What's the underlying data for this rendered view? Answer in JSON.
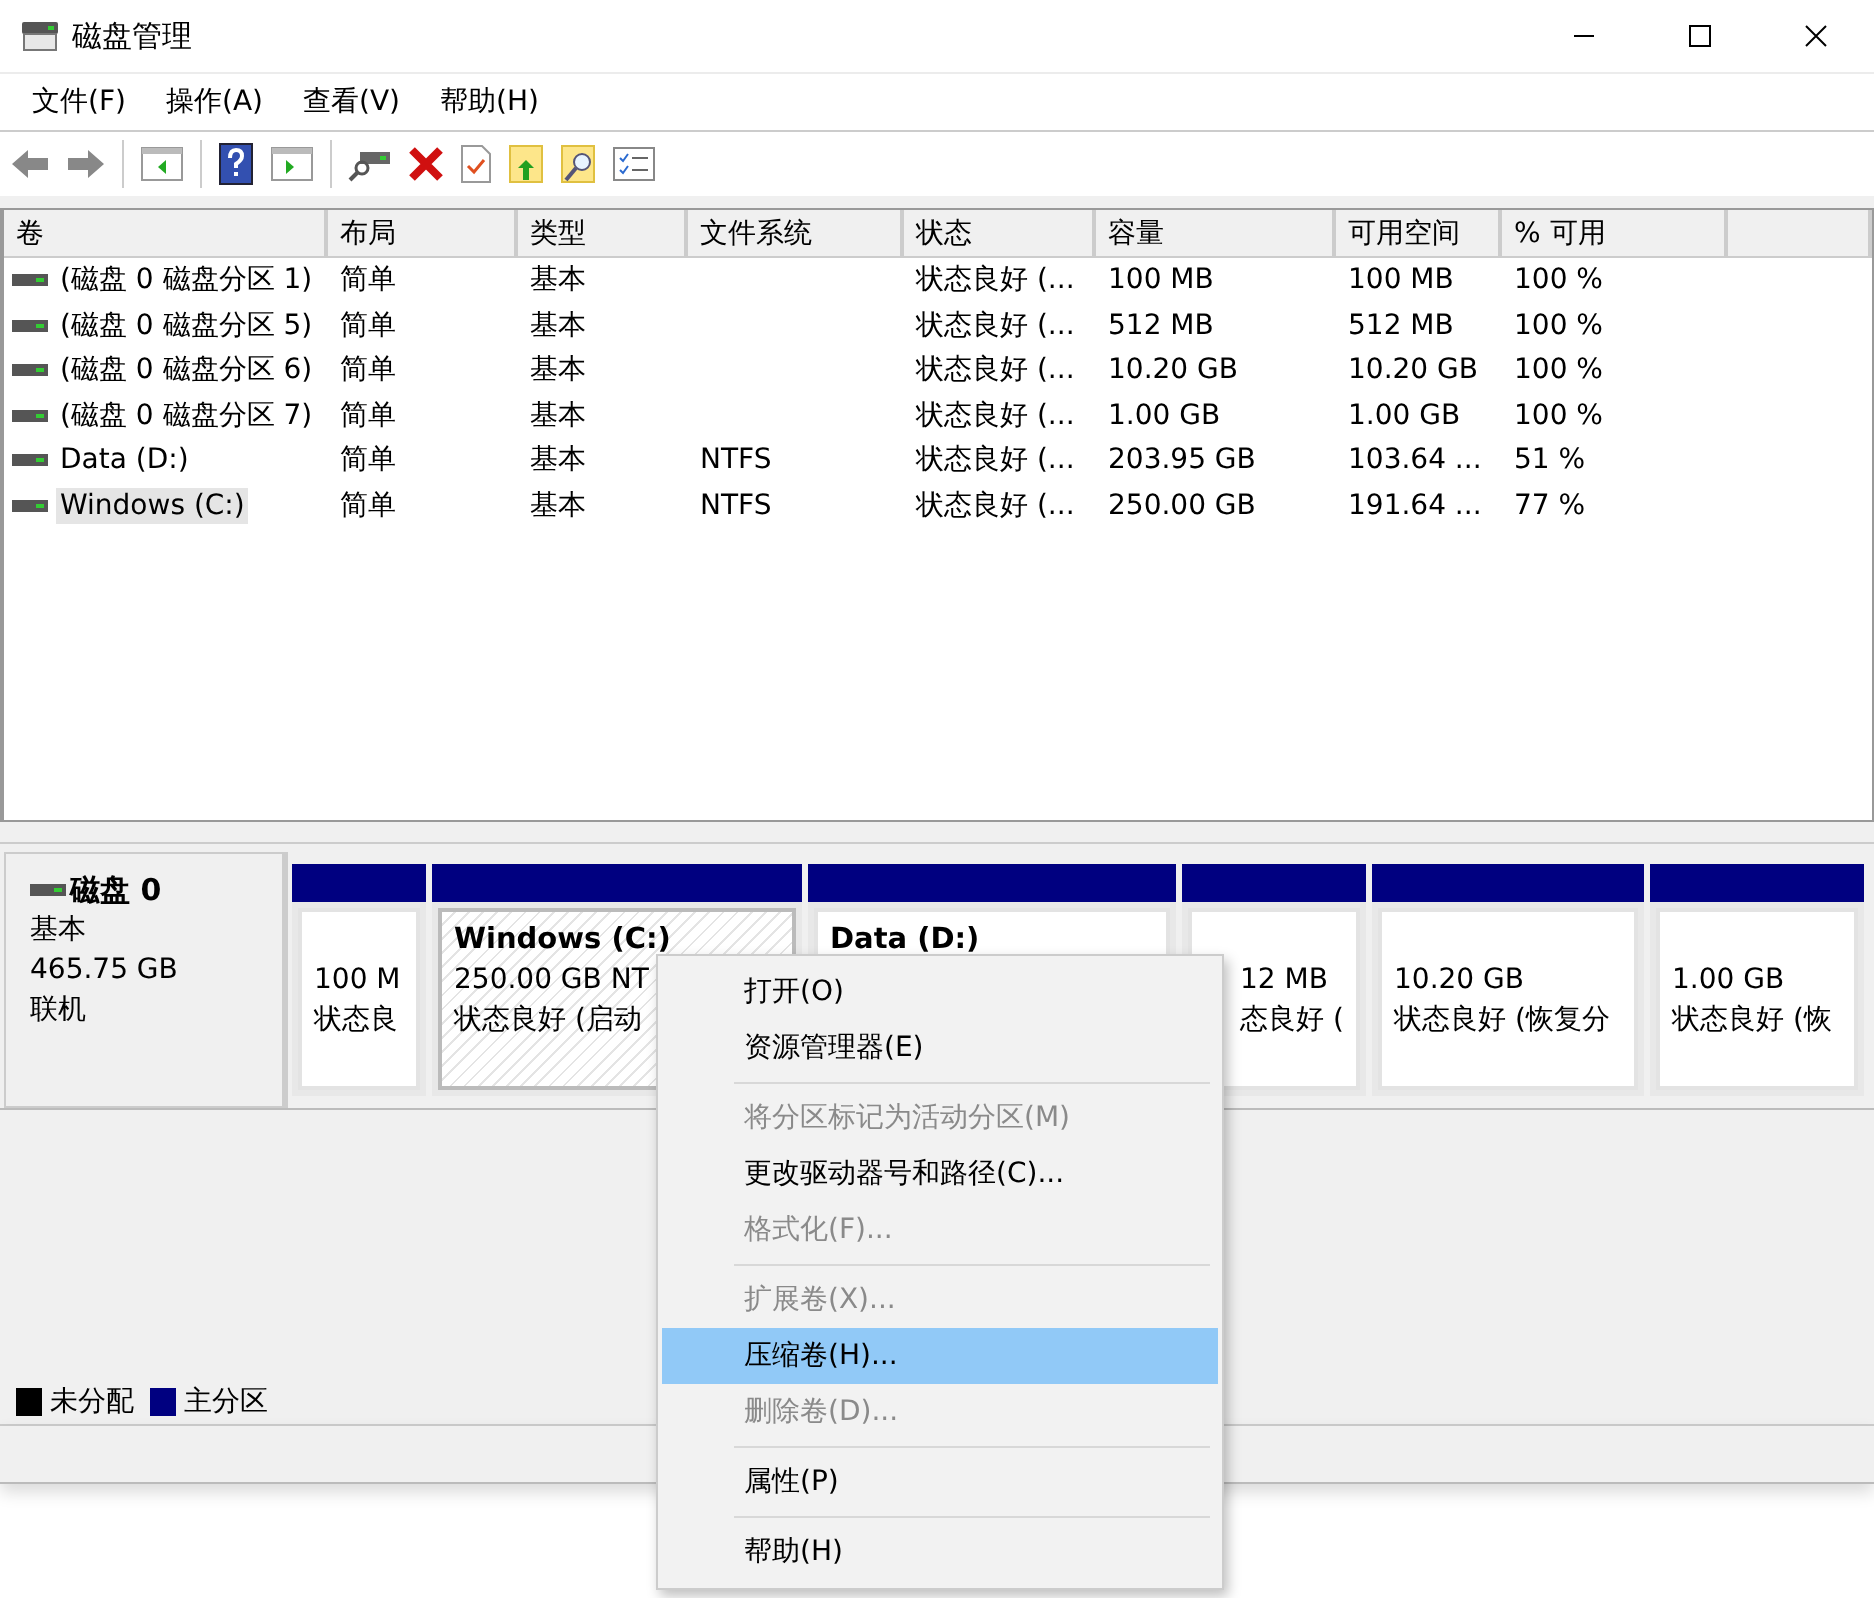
{
  "window": {
    "title": "磁盘管理"
  },
  "menu_bar": [
    "文件(F)",
    "操作(A)",
    "查看(V)",
    "帮助(H)"
  ],
  "volumes": {
    "columns": [
      "卷",
      "布局",
      "类型",
      "文件系统",
      "状态",
      "容量",
      "可用空间",
      "% 可用"
    ],
    "rows": [
      {
        "cells": [
          "(磁盘 0 磁盘分区 1)",
          "简单",
          "基本",
          "",
          "状态良好 (...",
          "100 MB",
          "100 MB",
          "100 %"
        ],
        "selected": false
      },
      {
        "cells": [
          "(磁盘 0 磁盘分区 5)",
          "简单",
          "基本",
          "",
          "状态良好 (...",
          "512 MB",
          "512 MB",
          "100 %"
        ],
        "selected": false
      },
      {
        "cells": [
          "(磁盘 0 磁盘分区 6)",
          "简单",
          "基本",
          "",
          "状态良好 (...",
          "10.20 GB",
          "10.20 GB",
          "100 %"
        ],
        "selected": false
      },
      {
        "cells": [
          "(磁盘 0 磁盘分区 7)",
          "简单",
          "基本",
          "",
          "状态良好 (...",
          "1.00 GB",
          "1.00 GB",
          "100 %"
        ],
        "selected": false
      },
      {
        "cells": [
          "Data (D:)",
          "简单",
          "基本",
          "NTFS",
          "状态良好 (...",
          "203.95 GB",
          "103.64 ...",
          "51 %"
        ],
        "selected": false
      },
      {
        "cells": [
          "Windows (C:)",
          "简单",
          "基本",
          "NTFS",
          "状态良好 (...",
          "250.00 GB",
          "191.64 ...",
          "77 %"
        ],
        "selected": true
      }
    ]
  },
  "disk": {
    "name": "磁盘 0",
    "type": "基本",
    "size": "465.75 GB",
    "status": "联机",
    "partitions": [
      {
        "lines": [
          "100 M",
          "状态良"
        ],
        "selected": false
      },
      {
        "title": "Windows  (C:)",
        "lines": [
          "250.00 GB NT",
          "状态良好 (启动"
        ],
        "selected": true
      },
      {
        "title": "Data  (D:)",
        "selected": false
      },
      {
        "lines": [
          "12 MB",
          "态良好 ("
        ],
        "selected": false
      },
      {
        "lines": [
          "10.20 GB",
          "状态良好 (恢复分"
        ],
        "selected": false
      },
      {
        "lines": [
          "1.00 GB",
          "状态良好 (恢"
        ],
        "selected": false
      }
    ]
  },
  "legend": [
    {
      "label": "未分配",
      "color": "#000000"
    },
    {
      "label": "主分区",
      "color": "#000080"
    }
  ],
  "context_menu": [
    {
      "kind": "item",
      "label": "打开(O)",
      "disabled": false,
      "selected": false
    },
    {
      "kind": "item",
      "label": "资源管理器(E)",
      "disabled": false,
      "selected": false
    },
    {
      "kind": "separator"
    },
    {
      "kind": "item",
      "label": "将分区标记为活动分区(M)",
      "disabled": true,
      "selected": false
    },
    {
      "kind": "item",
      "label": "更改驱动器号和路径(C)...",
      "disabled": false,
      "selected": false
    },
    {
      "kind": "item",
      "label": "格式化(F)...",
      "disabled": true,
      "selected": false
    },
    {
      "kind": "separator"
    },
    {
      "kind": "item",
      "label": "扩展卷(X)...",
      "disabled": true,
      "selected": false
    },
    {
      "kind": "item",
      "label": "压缩卷(H)...",
      "disabled": false,
      "selected": true
    },
    {
      "kind": "item",
      "label": "删除卷(D)...",
      "disabled": true,
      "selected": false
    },
    {
      "kind": "separator"
    },
    {
      "kind": "item",
      "label": "属性(P)",
      "disabled": false,
      "selected": false
    },
    {
      "kind": "separator"
    },
    {
      "kind": "item",
      "label": "帮助(H)",
      "disabled": false,
      "selected": false
    }
  ]
}
